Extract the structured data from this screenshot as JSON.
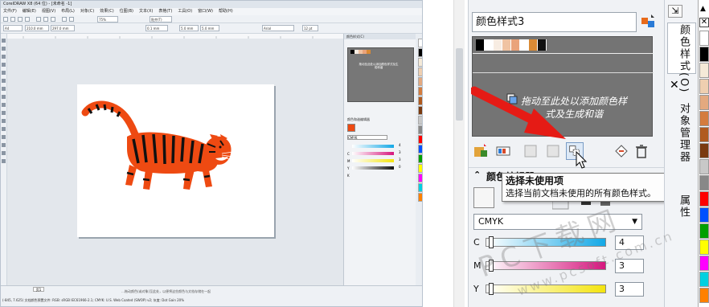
{
  "left": {
    "title": "CorelDRAW X8 (64 位) - [未命名 -1]",
    "menu": [
      "文件(F)",
      "编辑(E)",
      "视图(V)",
      "布局(L)",
      "对象(C)",
      "效果(C)",
      "位图(B)",
      "文本(X)",
      "表格(T)",
      "工具(O)",
      "窗口(W)",
      "帮助(H)"
    ],
    "zoom": "75%",
    "snap": "贴齐(T)",
    "font_name": "Arial",
    "font_size": "12 pt",
    "page_size": "A4",
    "w_value": "210.0 mm",
    "h_value": "297.0 mm",
    "nudge": "0.1 mm",
    "dup_x": "5.0 mm",
    "dup_y": "5.0 mm",
    "docker_title": "颜色样式(C)",
    "docker_drop": "拖动至此处以添加颜色样式及生成和谐",
    "color_section": "颜色和谐编辑器",
    "color_mode": "CMYK",
    "sliders": [
      {
        "label": "C",
        "value": "4"
      },
      {
        "label": "M",
        "value": "3"
      },
      {
        "label": "Y",
        "value": "3"
      },
      {
        "label": "K",
        "value": "0"
      }
    ],
    "page_tab": "页1",
    "status_hint": "…拖动颜色(或对象)至此处，以便将这些颜色与文档存储在一起",
    "status_info": "(-845, 7.625)   文档颜色预置文件: RGB: sRGB IEC61966-2.1; CMYK: U.S. Web Coated (SWOP) v2; 灰度: Dot Gain 20%"
  },
  "right": {
    "library_name": "颜色样式3",
    "library_swatches": [
      "#000000",
      "#ffffff",
      "#f7ece2",
      "#f0c3a2",
      "#eaa37a",
      "#ffffff",
      "#d98a35",
      "#111111"
    ],
    "drop_message": "拖动至此处以添加颜色样式及生成和谐",
    "section_title": "颜色编辑器",
    "tooltip_title": "选择未使用项",
    "tooltip_desc": "选择当前文档未使用的所有颜色样式。",
    "color_mode": "CMYK",
    "sliders": [
      {
        "label": "C",
        "value": "4"
      },
      {
        "label": "M",
        "value": "3"
      },
      {
        "label": "Y",
        "value": "3"
      }
    ],
    "tab_color_styles": "颜色样式(O)",
    "tab_object_manager": "对象管理器",
    "tab_properties": "属性",
    "watermark": "PC下载网",
    "watermark_url": "www.pcsoft.com.cn"
  },
  "colors": {
    "tiger_orange": "#ee4a12",
    "arrow_red": "#e51b15",
    "library_bg": "#747474",
    "c_gradient": "#13a8e6",
    "m_gradient": "#d6177e",
    "y_gradient": "#f4e40e"
  },
  "palette": [
    "#ffffff",
    "#000000",
    "#f5ead8",
    "#efcfb0",
    "#e4a97f",
    "#d47c3e",
    "#b05a1e",
    "#7a3a10",
    "#c8c8c8",
    "#888888",
    "#ff0000",
    "#0050ff",
    "#00a000",
    "#ffff00",
    "#ff00ff",
    "#00d0e0",
    "#ff8000"
  ]
}
